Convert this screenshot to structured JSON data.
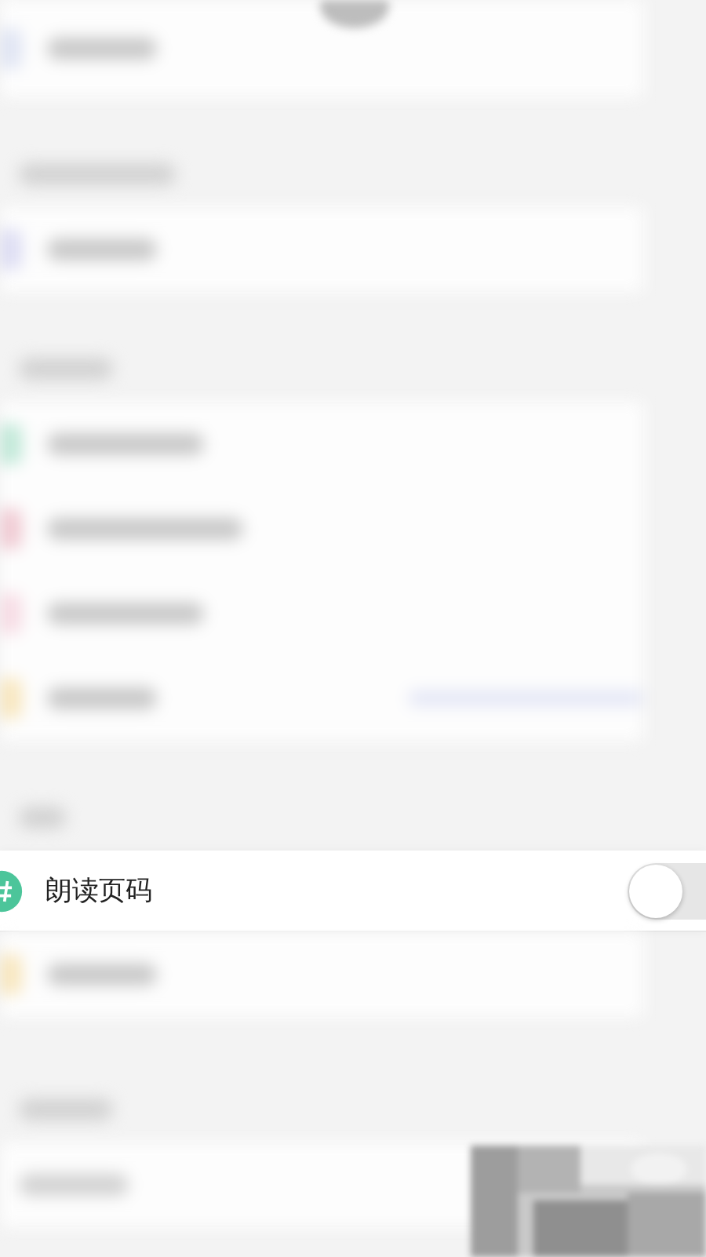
{
  "settings_row": {
    "label": "朗读页码",
    "on": false
  }
}
